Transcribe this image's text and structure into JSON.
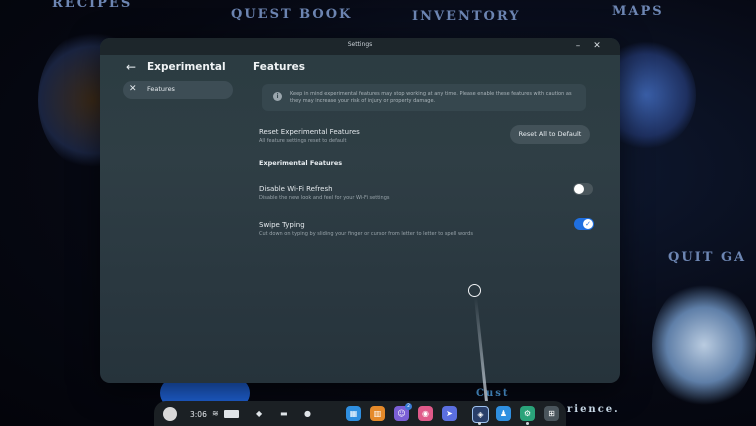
{
  "background": {
    "labels": [
      "RECIPES",
      "QUEST BOOK",
      "INVENTORY",
      "MAPS",
      "QUIT GA",
      "Cust",
      "rience."
    ]
  },
  "window": {
    "title": "Settings",
    "minimize_icon": "minimize-icon",
    "close_icon": "close-icon"
  },
  "sidebar": {
    "back_icon": "arrow-left-icon",
    "heading": "Experimental",
    "items": [
      {
        "label": "Features",
        "icon": "tools-icon",
        "selected": true
      }
    ]
  },
  "main": {
    "heading": "Features",
    "notice": "Keep in mind experimental features may stop working at any time. Please enable these features with caution as they may increase your risk of injury or property damage.",
    "reset": {
      "title": "Reset Experimental Features",
      "subtitle": "All feature settings reset to default",
      "button": "Reset All to Default"
    },
    "section": "Experimental Features",
    "features": [
      {
        "title": "Disable Wi-Fi Refresh",
        "subtitle": "Disable the new look and feel for your Wi-Fi settings",
        "enabled": false
      },
      {
        "title": "Swipe Typing",
        "subtitle": "Cut down on typing by sliding your finger or cursor from letter to letter to spell words",
        "enabled": true
      }
    ]
  },
  "taskbar": {
    "time": "3:06",
    "apps": [
      {
        "icon": "store-icon",
        "color": "#2f8fe0"
      },
      {
        "icon": "library-icon",
        "color": "#e58a2a"
      },
      {
        "icon": "people-icon",
        "color": "#7b5fd6",
        "badge": "2"
      },
      {
        "icon": "camera-icon",
        "color": "#e05a8a"
      },
      {
        "icon": "share-icon",
        "color": "#5b6fe0"
      },
      {
        "icon": "game-icon",
        "color": "#2a3f6a"
      },
      {
        "icon": "avatar-icon",
        "color": "#2f8fe0"
      },
      {
        "icon": "settings-icon",
        "color": "#2aa37a"
      },
      {
        "icon": "app-grid-icon",
        "color": "#4a555c"
      }
    ]
  }
}
